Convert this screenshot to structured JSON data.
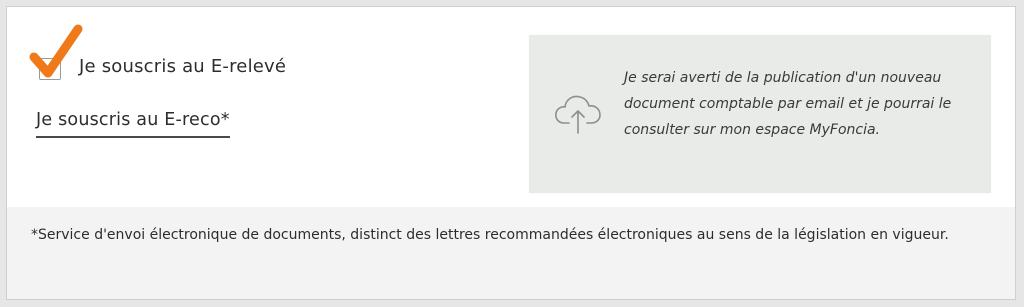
{
  "options": {
    "ereleve_label": "Je souscris au E-relevé",
    "ereleve_checked": true,
    "ereco_label": "Je souscris au E-reco*"
  },
  "info_box": {
    "icon": "cloud-upload-icon",
    "text": "Je serai averti de la publication d'un nouveau document comptable par email et je pourrai le consulter sur mon espace MyFoncia."
  },
  "footnote": {
    "text": "*Service d'envoi électronique de documents, distinct des lettres recommandées électroniques au sens de la législation en vigueur."
  },
  "colors": {
    "checkmark": "#f07a1a",
    "info_box_bg": "#e9ebe8",
    "footnote_bg": "#f3f3f3"
  }
}
